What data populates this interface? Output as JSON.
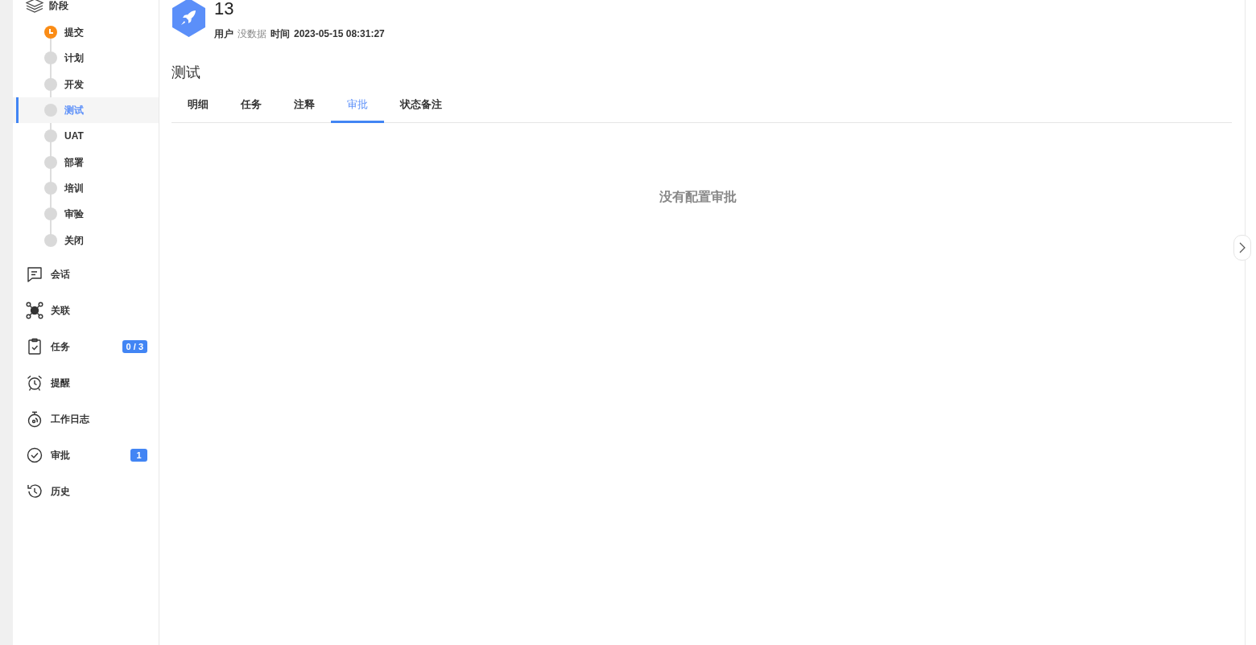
{
  "sidebar": {
    "stage_header": "阶段",
    "stages": [
      {
        "label": "提交",
        "current": true,
        "selected": false
      },
      {
        "label": "计划",
        "current": false,
        "selected": false
      },
      {
        "label": "开发",
        "current": false,
        "selected": false
      },
      {
        "label": "测试",
        "current": false,
        "selected": true
      },
      {
        "label": "UAT",
        "current": false,
        "selected": false
      },
      {
        "label": "部署",
        "current": false,
        "selected": false
      },
      {
        "label": "培训",
        "current": false,
        "selected": false
      },
      {
        "label": "审验",
        "current": false,
        "selected": false
      },
      {
        "label": "关闭",
        "current": false,
        "selected": false
      }
    ],
    "items": [
      {
        "kind": "chat",
        "label": "会话"
      },
      {
        "kind": "link",
        "label": "关联"
      },
      {
        "kind": "task",
        "label": "任务",
        "badge": "0 / 3"
      },
      {
        "kind": "alarm",
        "label": "提醒"
      },
      {
        "kind": "timer",
        "label": "工作日志"
      },
      {
        "kind": "approve",
        "label": "审批",
        "badge": "1"
      },
      {
        "kind": "history",
        "label": "历史"
      }
    ]
  },
  "header": {
    "number": "13",
    "user_label": "用户",
    "user_value": "没数据",
    "time_label": "时间",
    "time_value": "2023-05-15 08:31:27"
  },
  "section_title": "测试",
  "tabs": [
    {
      "label": "明细",
      "selected": false
    },
    {
      "label": "任务",
      "selected": false
    },
    {
      "label": "注释",
      "selected": false
    },
    {
      "label": "审批",
      "selected": true
    },
    {
      "label": "状态备注",
      "selected": false
    }
  ],
  "empty_message": "没有配置审批"
}
